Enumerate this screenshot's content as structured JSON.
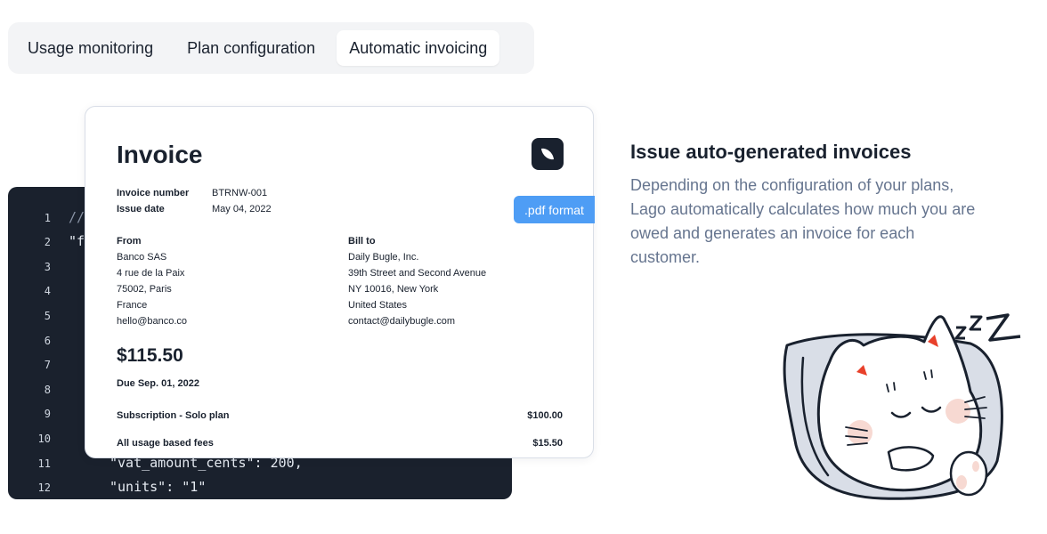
{
  "tabs": [
    {
      "label": "Usage monitoring",
      "active": false
    },
    {
      "label": "Plan configuration",
      "active": false
    },
    {
      "label": "Automatic invoicing",
      "active": true
    }
  ],
  "code": {
    "lines": [
      {
        "n": "1",
        "text": "//"
      },
      {
        "n": "2",
        "text": "\"f"
      },
      {
        "n": "3",
        "text": ""
      },
      {
        "n": "4",
        "text": ""
      },
      {
        "n": "5",
        "text": ""
      },
      {
        "n": "6",
        "text": ""
      },
      {
        "n": "7",
        "text": ""
      },
      {
        "n": "8",
        "text": ""
      },
      {
        "n": "9",
        "text": ""
      },
      {
        "n": "10",
        "text": ""
      },
      {
        "n": "11",
        "text": "\"vat_amount_cents\": 200,"
      },
      {
        "n": "12",
        "text": "\"units\": \"1\""
      }
    ]
  },
  "invoice": {
    "title": "Invoice",
    "pdf_badge": ".pdf format",
    "number_label": "Invoice number",
    "number_value": "BTRNW-001",
    "date_label": "Issue date",
    "date_value": "May 04, 2022",
    "from_label": "From",
    "from_lines": [
      "Banco SAS",
      "4 rue de la Paix",
      "75002, Paris",
      "France",
      "hello@banco.co"
    ],
    "bill_label": "Bill to",
    "bill_lines": [
      "Daily Bugle, Inc.",
      "39th Street and Second Avenue",
      "NY 10016, New York",
      "United States",
      "contact@dailybugle.com"
    ],
    "amount": "$115.50",
    "due": "Due Sep. 01, 2022",
    "items": [
      {
        "label": "Subscription - Solo plan",
        "value": "$100.00"
      },
      {
        "label": "All usage based fees",
        "value": "$15.50"
      }
    ]
  },
  "feature": {
    "heading": "Issue auto-generated invoices",
    "body": "Depending on the configuration of your plans, Lago automatically calculates how much you are owed and generates an invoice for each customer."
  },
  "colors": {
    "accent": "#4e9df5",
    "dark": "#19212e",
    "muted": "#66758f",
    "code_bg": "#1a212d"
  },
  "icons": {
    "logo": "leaf-logo-icon",
    "illustration": "sleeping-cat-illustration"
  }
}
